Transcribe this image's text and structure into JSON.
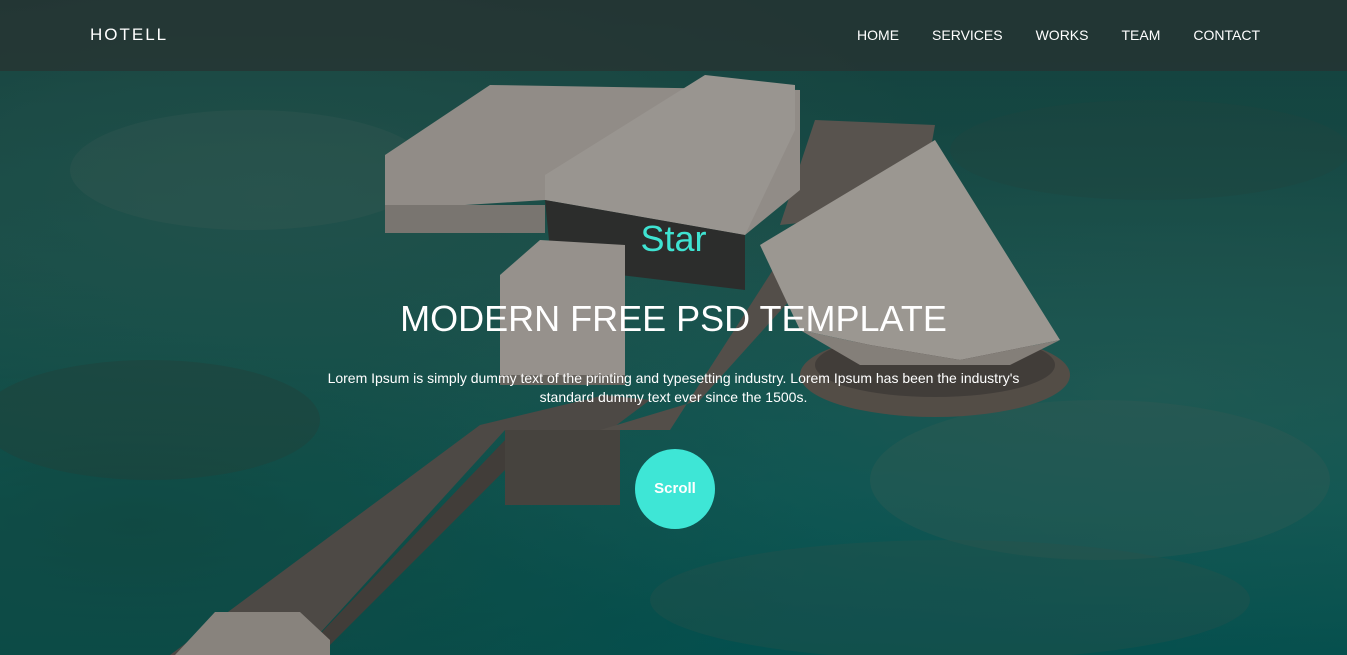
{
  "header": {
    "brand": "HOTELL",
    "nav": [
      "HOME",
      "SERVICES",
      "WORKS",
      "TEAM",
      "CONTACT"
    ]
  },
  "hero": {
    "eyebrow": "Star",
    "headline": "MODERN FREE PSD TEMPLATE",
    "description": "Lorem Ipsum is simply dummy text of the printing and typesetting industry. Lorem Ipsum has been the industry's standard dummy text ever since the 1500s.",
    "button": "Scroll"
  },
  "colors": {
    "accent": "#3ee6d6",
    "nav_bg": "#283230",
    "sea": "#0f7a74"
  }
}
